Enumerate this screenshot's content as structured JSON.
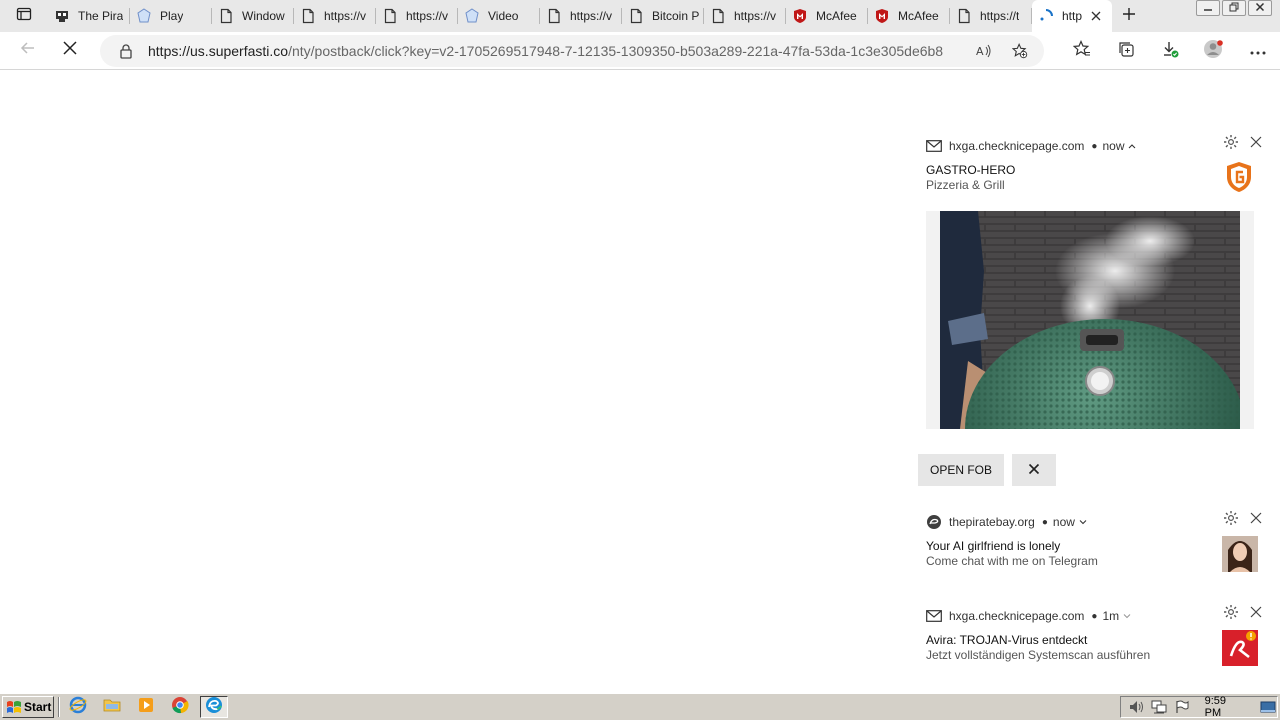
{
  "tabs": [
    {
      "label": "The Pira",
      "icon": "pirate-icon"
    },
    {
      "label": "Play",
      "icon": "generic-site-icon"
    },
    {
      "label": "Window",
      "icon": "page-icon"
    },
    {
      "label": "https://v",
      "icon": "page-icon"
    },
    {
      "label": "https://v",
      "icon": "page-icon"
    },
    {
      "label": "Video",
      "icon": "generic-site-icon"
    },
    {
      "label": "https://v",
      "icon": "page-icon"
    },
    {
      "label": "Bitcoin P",
      "icon": "page-icon"
    },
    {
      "label": "https://v",
      "icon": "page-icon"
    },
    {
      "label": "McAfee",
      "icon": "mcafee-icon"
    },
    {
      "label": "McAfee",
      "icon": "mcafee-icon"
    },
    {
      "label": "https://t",
      "icon": "page-icon"
    },
    {
      "label": "http",
      "icon": "loading-icon",
      "active": true
    }
  ],
  "address": {
    "host": "https://us.superfasti.co",
    "path": "/nty/postback/click?key=v2-1705269517948-7-12135-1309350-b503a289-221a-47fa-53da-1c3e305de6b8"
  },
  "notifications": [
    {
      "source": "hxga.checknicepage.com",
      "time": "now",
      "title": "GASTRO-HERO",
      "body": "Pizzeria & Grill",
      "buttons": [
        "OPEN FOB"
      ]
    },
    {
      "source": "thepiratebay.org",
      "time": "now",
      "title": "Your AI girlfriend is lonely",
      "body": "Come chat with me on Telegram"
    },
    {
      "source": "hxga.checknicepage.com",
      "time": "1m",
      "title": "Avira: TROJAN-Virus entdeckt",
      "body": "Jetzt vollständigen Systemscan ausführen"
    }
  ],
  "taskbar": {
    "start_label": "Start",
    "clock": "9:59 PM"
  },
  "colors": {
    "tabstrip": "#e8e8e8",
    "omnibox": "#f3f3f3",
    "mcafee_red": "#c01818",
    "avira_red": "#d8202a",
    "gastro_orange": "#e8731a",
    "taskbar": "#d4d0c8"
  }
}
